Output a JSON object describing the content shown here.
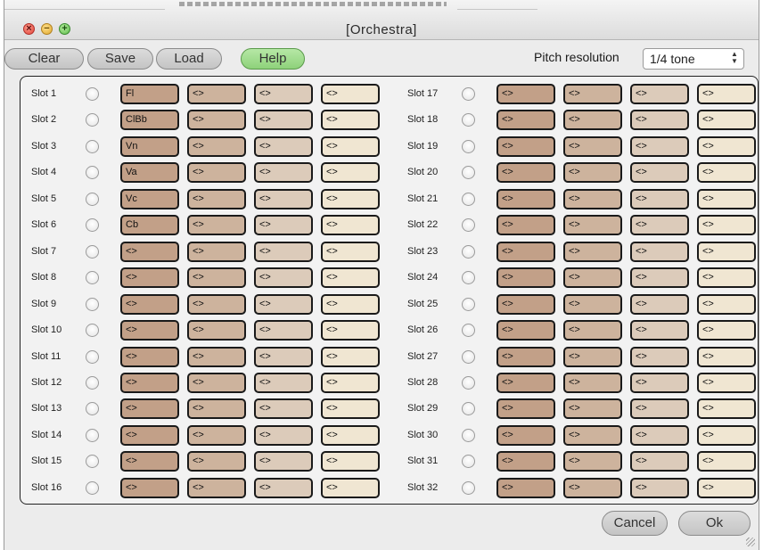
{
  "window": {
    "title": "[Orchestra]"
  },
  "toolbar": {
    "clear_label": "Clear",
    "save_label": "Save",
    "load_label": "Load",
    "help_label": "Help",
    "pitch_resolution_label": "Pitch resolution",
    "pitch_resolution_value": "1/4 tone"
  },
  "slots": [
    {
      "label": "Slot 1",
      "cells": [
        "Fl",
        "<>",
        "<>",
        "<>"
      ]
    },
    {
      "label": "Slot 2",
      "cells": [
        "ClBb",
        "<>",
        "<>",
        "<>"
      ]
    },
    {
      "label": "Slot 3",
      "cells": [
        "Vn",
        "<>",
        "<>",
        "<>"
      ]
    },
    {
      "label": "Slot 4",
      "cells": [
        "Va",
        "<>",
        "<>",
        "<>"
      ]
    },
    {
      "label": "Slot 5",
      "cells": [
        "Vc",
        "<>",
        "<>",
        "<>"
      ]
    },
    {
      "label": "Slot 6",
      "cells": [
        "Cb",
        "<>",
        "<>",
        "<>"
      ]
    },
    {
      "label": "Slot 7",
      "cells": [
        "<>",
        "<>",
        "<>",
        "<>"
      ]
    },
    {
      "label": "Slot 8",
      "cells": [
        "<>",
        "<>",
        "<>",
        "<>"
      ]
    },
    {
      "label": "Slot 9",
      "cells": [
        "<>",
        "<>",
        "<>",
        "<>"
      ]
    },
    {
      "label": "Slot 10",
      "cells": [
        "<>",
        "<>",
        "<>",
        "<>"
      ]
    },
    {
      "label": "Slot 11",
      "cells": [
        "<>",
        "<>",
        "<>",
        "<>"
      ]
    },
    {
      "label": "Slot 12",
      "cells": [
        "<>",
        "<>",
        "<>",
        "<>"
      ]
    },
    {
      "label": "Slot 13",
      "cells": [
        "<>",
        "<>",
        "<>",
        "<>"
      ]
    },
    {
      "label": "Slot 14",
      "cells": [
        "<>",
        "<>",
        "<>",
        "<>"
      ]
    },
    {
      "label": "Slot 15",
      "cells": [
        "<>",
        "<>",
        "<>",
        "<>"
      ]
    },
    {
      "label": "Slot 16",
      "cells": [
        "<>",
        "<>",
        "<>",
        "<>"
      ]
    },
    {
      "label": "Slot 17",
      "cells": [
        "<>",
        "<>",
        "<>",
        "<>"
      ]
    },
    {
      "label": "Slot 18",
      "cells": [
        "<>",
        "<>",
        "<>",
        "<>"
      ]
    },
    {
      "label": "Slot 19",
      "cells": [
        "<>",
        "<>",
        "<>",
        "<>"
      ]
    },
    {
      "label": "Slot 20",
      "cells": [
        "<>",
        "<>",
        "<>",
        "<>"
      ]
    },
    {
      "label": "Slot 21",
      "cells": [
        "<>",
        "<>",
        "<>",
        "<>"
      ]
    },
    {
      "label": "Slot 22",
      "cells": [
        "<>",
        "<>",
        "<>",
        "<>"
      ]
    },
    {
      "label": "Slot 23",
      "cells": [
        "<>",
        "<>",
        "<>",
        "<>"
      ]
    },
    {
      "label": "Slot 24",
      "cells": [
        "<>",
        "<>",
        "<>",
        "<>"
      ]
    },
    {
      "label": "Slot 25",
      "cells": [
        "<>",
        "<>",
        "<>",
        "<>"
      ]
    },
    {
      "label": "Slot 26",
      "cells": [
        "<>",
        "<>",
        "<>",
        "<>"
      ]
    },
    {
      "label": "Slot 27",
      "cells": [
        "<>",
        "<>",
        "<>",
        "<>"
      ]
    },
    {
      "label": "Slot 28",
      "cells": [
        "<>",
        "<>",
        "<>",
        "<>"
      ]
    },
    {
      "label": "Slot 29",
      "cells": [
        "<>",
        "<>",
        "<>",
        "<>"
      ]
    },
    {
      "label": "Slot 30",
      "cells": [
        "<>",
        "<>",
        "<>",
        "<>"
      ]
    },
    {
      "label": "Slot 31",
      "cells": [
        "<>",
        "<>",
        "<>",
        "<>"
      ]
    },
    {
      "label": "Slot 32",
      "cells": [
        "<>",
        "<>",
        "<>",
        "<>"
      ]
    }
  ],
  "footer": {
    "cancel_label": "Cancel",
    "ok_label": "Ok"
  },
  "colors": {
    "cell_column_1": "#c2a088",
    "cell_column_2": "#cdb39d",
    "cell_column_3": "#dccbba",
    "cell_column_4": "#f0e6d2",
    "help_button": "#9ed88a"
  },
  "icons": {
    "close": "close-icon",
    "minimize": "minimize-icon",
    "maximize": "maximize-icon",
    "stepper": "up-down-arrows-icon",
    "resize": "resize-grip-icon"
  }
}
